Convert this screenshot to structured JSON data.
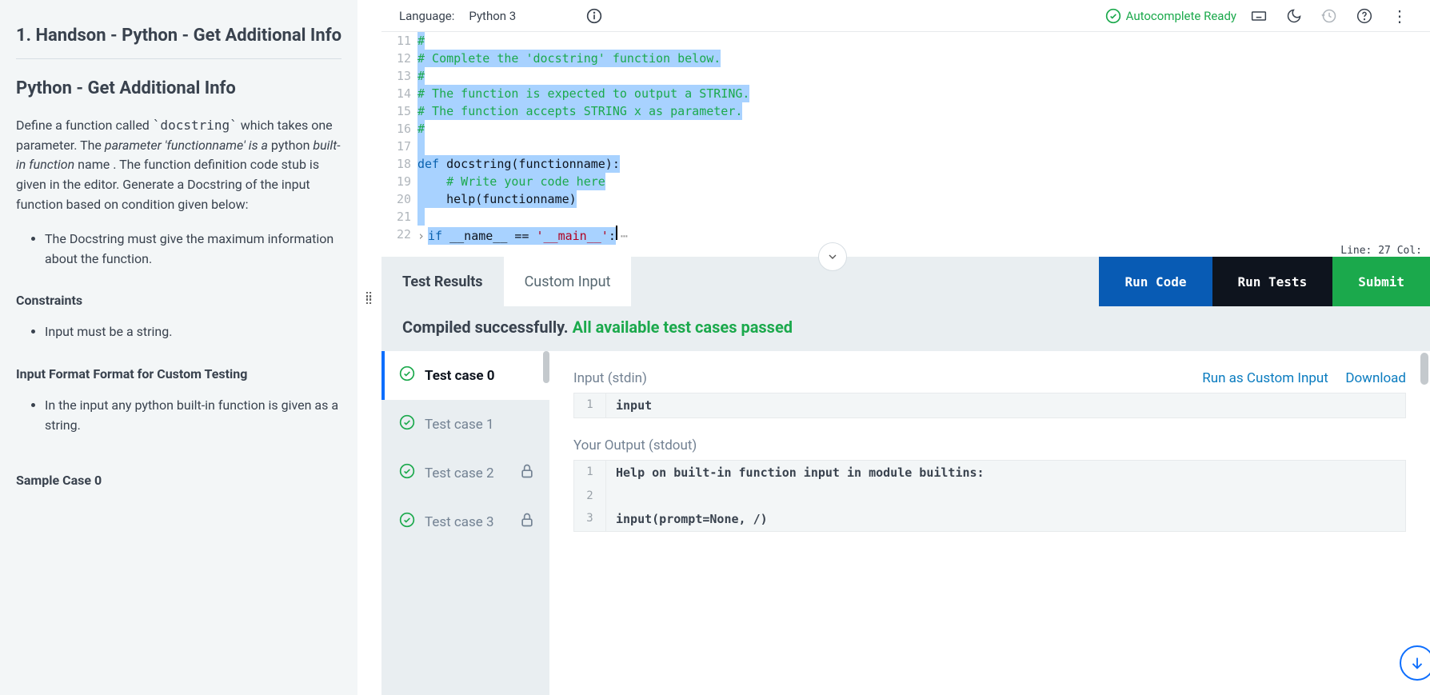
{
  "problem": {
    "title_full": "1. Handson - Python - Get Additional Info",
    "subtitle": "Python - Get Additional Info",
    "desc_pre": "Define a function called ",
    "desc_code": "`docstring`",
    "desc_mid": " which takes one parameter. The ",
    "desc_em1": "parameter 'functionname' is a",
    "desc_mid2": " python ",
    "desc_em2": "built-in function",
    "desc_post": " name . The function definition code stub is given in the editor. Generate a Docstring of the input function based on condition given below:",
    "bullet1": "The Docstring must give the maximum information about the function.",
    "constraints_label": "Constraints",
    "constraint_item": "Input must be a string.",
    "input_format_label": "Input Format Format for Custom Testing",
    "input_format_item": "In the input any python built-in function is given as a string.",
    "sample_case_label": "Sample Case 0"
  },
  "topbar": {
    "language_label": "Language:",
    "language_value": "Python 3",
    "autocomplete": "Autocomplete Ready"
  },
  "editor": {
    "lines": {
      "11": "#",
      "12": "# Complete the 'docstring' function below.",
      "13": "#",
      "14": "# The function is expected to output a STRING.",
      "15": "# The function accepts STRING x as parameter.",
      "16": "#",
      "18a": "def ",
      "18b": "docstring(functionname):",
      "19": "    # Write your code here",
      "20a": "    help(functionname)",
      "22a": "if ",
      "22b": "__name__ ",
      "22c": "== ",
      "22d": "'__main__'",
      "22e": ":"
    },
    "status": "Line: 27 Col:"
  },
  "results": {
    "tabs": {
      "test_results": "Test Results",
      "custom_input": "Custom Input"
    },
    "buttons": {
      "run_code": "Run Code",
      "run_tests": "Run Tests",
      "submit": "Submit"
    },
    "compiled": "Compiled successfully.",
    "pass_msg": "All available test cases passed",
    "testcases": [
      "Test case 0",
      "Test case 1",
      "Test case 2",
      "Test case 3"
    ],
    "detail": {
      "input_label": "Input (stdin)",
      "link_run_custom": "Run as Custom Input",
      "link_download": "Download",
      "input_val": "input",
      "output_label": "Your Output (stdout)",
      "out1": "Help on built-in function input in module builtins:",
      "out2": "",
      "out3": "input(prompt=None, /)"
    }
  }
}
